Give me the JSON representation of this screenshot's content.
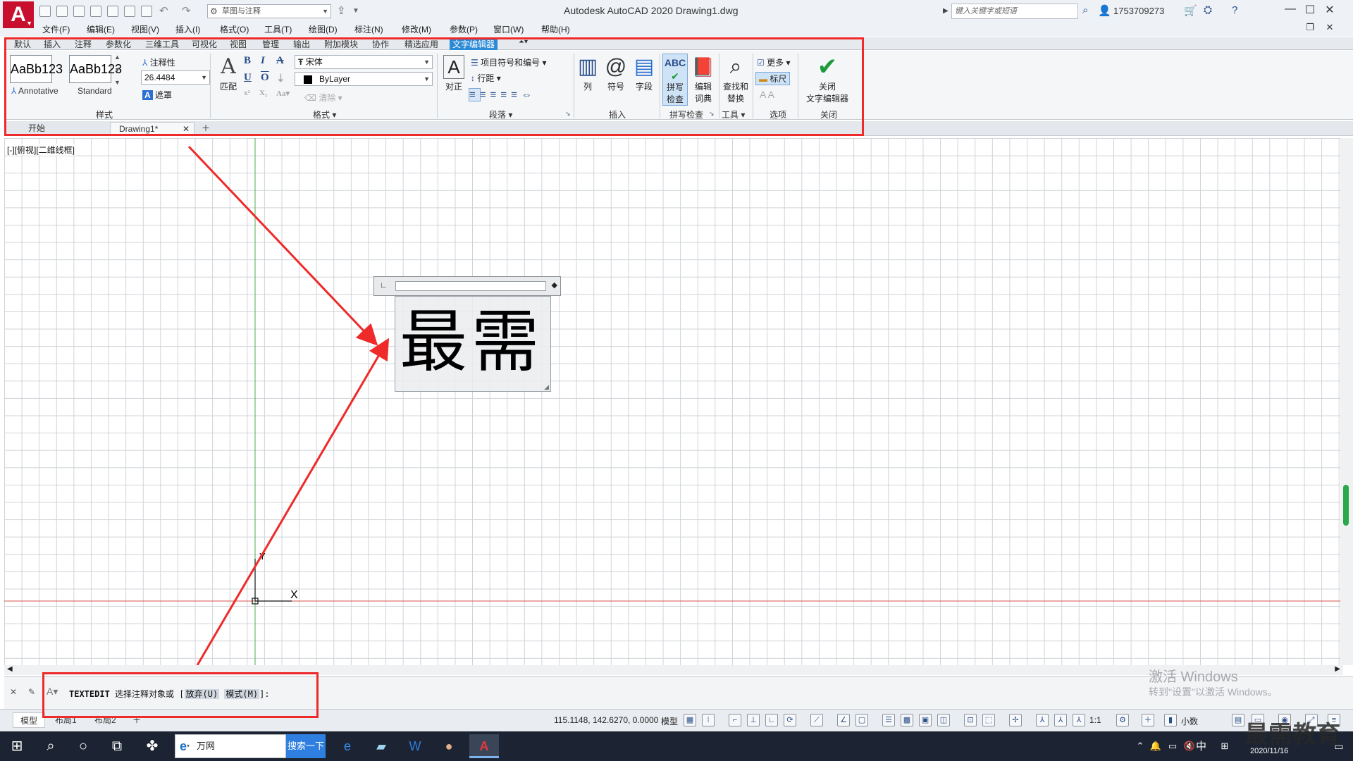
{
  "app": {
    "logo_letter": "A",
    "window_title": "Autodesk AutoCAD 2020    Drawing1.dwg",
    "workspace": "草图与注释",
    "search_placeholder": "键入关键字或短语",
    "user": "1753709273"
  },
  "menu": [
    "文件(F)",
    "编辑(E)",
    "视图(V)",
    "插入(I)",
    "格式(O)",
    "工具(T)",
    "绘图(D)",
    "标注(N)",
    "修改(M)",
    "参数(P)",
    "窗口(W)",
    "帮助(H)"
  ],
  "ribbon_tabs": [
    "默认",
    "插入",
    "注释",
    "参数化",
    "三维工具",
    "可视化",
    "视图",
    "管理",
    "输出",
    "附加模块",
    "协作",
    "精选应用",
    "文字编辑器"
  ],
  "ribbon_active_tab": "文字编辑器",
  "ribbon": {
    "style_panel": {
      "swatch_1": "AaBb123",
      "swatch_1_caption": "Annotative",
      "swatch_2": "AaBb123",
      "swatch_2_caption": "Standard",
      "annotative_label": "注释性",
      "text_height": "26.4484",
      "mask_label": "遮罩",
      "title": "样式"
    },
    "format_panel": {
      "match_label": "匹配",
      "bold": "B",
      "italic": "I",
      "strike": "A",
      "underline": "U",
      "overline": "O",
      "font": "宋体",
      "color": "ByLayer",
      "clear_label": "清除",
      "title": "格式"
    },
    "paragraph_panel": {
      "justify_label": "对正",
      "bullets_label": "项目符号和编号",
      "line_spacing_label": "行距",
      "title": "段落"
    },
    "insert_panel": {
      "columns_label": "列",
      "symbol_label": "符号",
      "field_label": "字段",
      "title": "插入"
    },
    "spell_panel": {
      "spell_check_label_1": "拼写",
      "spell_check_label_2": "检查",
      "edit_dict_label_1": "编辑",
      "edit_dict_label_2": "词典",
      "title": "拼写检查"
    },
    "tools_panel": {
      "find_label_1": "查找和",
      "find_label_2": "替换",
      "title": "工具"
    },
    "options_panel": {
      "more_label": "更多",
      "ruler_label": "标尺",
      "title": "选项"
    },
    "close_panel": {
      "close_label_1": "关闭",
      "close_label_2": "文字编辑器",
      "title": "关闭"
    }
  },
  "file_tabs": [
    "开始",
    "Drawing1*"
  ],
  "viewport_label": "[-][俯视][二维线框]",
  "mtext": {
    "content": "最需"
  },
  "ucs": {
    "x_label": "X",
    "y_label": "Y"
  },
  "command": {
    "name": "TEXTEDIT",
    "prompt": "选择注释对象或",
    "option_1": "放弃(U)",
    "option_2": "模式(M)"
  },
  "watermark": {
    "line1": "激活 Windows",
    "line2": "转到\"设置\"以激活 Windows。"
  },
  "layout_tabs": [
    "模型",
    "布局1",
    "布局2"
  ],
  "status": {
    "coords": "115.1148, 142.6270, 0.0000",
    "model_label": "模型",
    "scale": "1:1",
    "units": "小数"
  },
  "taskbar": {
    "browser_label": "万网",
    "search_button": "搜索一下",
    "ime": "中",
    "date": "2020/11/16"
  },
  "brand_watermark": "最需教育",
  "colors": {
    "accent_tab": "#2b8ad6",
    "highlight_red": "#ee2a2a",
    "logo_red": "#c8102e"
  }
}
